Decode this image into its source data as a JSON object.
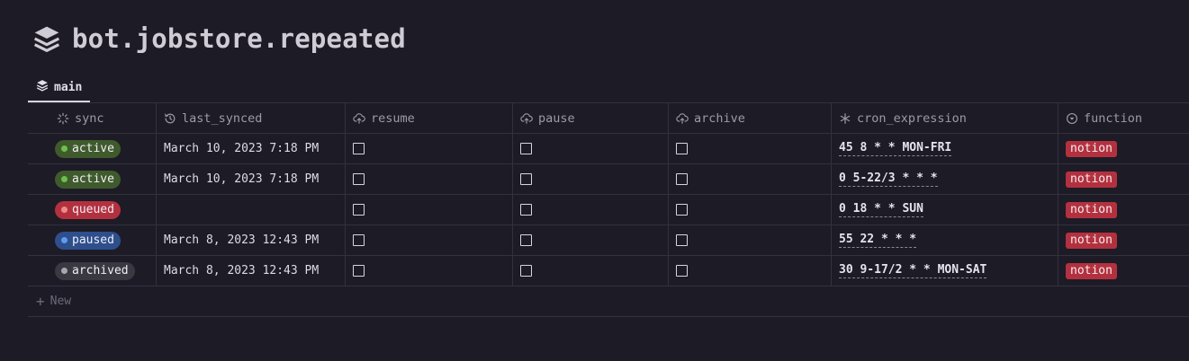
{
  "page": {
    "title": "bot.jobstore.repeated",
    "title_icon": "layers-icon"
  },
  "tabs": [
    {
      "label": "main",
      "icon": "layers-icon"
    }
  ],
  "columns": [
    {
      "label": "sync",
      "icon": "loader-icon"
    },
    {
      "label": "last_synced",
      "icon": "history-icon"
    },
    {
      "label": "resume",
      "icon": "cloud-upload-icon"
    },
    {
      "label": "pause",
      "icon": "cloud-upload-icon"
    },
    {
      "label": "archive",
      "icon": "cloud-upload-icon"
    },
    {
      "label": "cron_expression",
      "icon": "asterisk-icon"
    },
    {
      "label": "function",
      "icon": "circle-chevron-down-icon"
    }
  ],
  "rows": [
    {
      "sync": "active",
      "sync_color": "#3f5a2c",
      "dot_color": "#6cc04a",
      "last_synced": "March 10, 2023 7:18 PM",
      "resume": false,
      "pause": false,
      "archive": false,
      "cron_expression": "45 8 * * MON-FRI",
      "function": "notion"
    },
    {
      "sync": "active",
      "sync_color": "#3f5a2c",
      "dot_color": "#6cc04a",
      "last_synced": "March 10, 2023 7:18 PM",
      "resume": false,
      "pause": false,
      "archive": false,
      "cron_expression": "0 5-22/3 * * *",
      "function": "notion"
    },
    {
      "sync": "queued",
      "sync_color": "#b3313f",
      "dot_color": "#f08a8a",
      "last_synced": "",
      "resume": false,
      "pause": false,
      "archive": false,
      "cron_expression": "0 18 * * SUN",
      "function": "notion"
    },
    {
      "sync": "paused",
      "sync_color": "#2e4f8c",
      "dot_color": "#5f9bf0",
      "last_synced": "March 8, 2023 12:43 PM",
      "resume": false,
      "pause": false,
      "archive": false,
      "cron_expression": "55 22 * * *",
      "function": "notion"
    },
    {
      "sync": "archived",
      "sync_color": "#3a3841",
      "dot_color": "#a9a6ae",
      "last_synced": "March 8, 2023 12:43 PM",
      "resume": false,
      "pause": false,
      "archive": false,
      "cron_expression": "30 9-17/2 * * MON-SAT",
      "function": "notion"
    }
  ],
  "function_tag_color": "#b3313f",
  "new_row_label": "New"
}
